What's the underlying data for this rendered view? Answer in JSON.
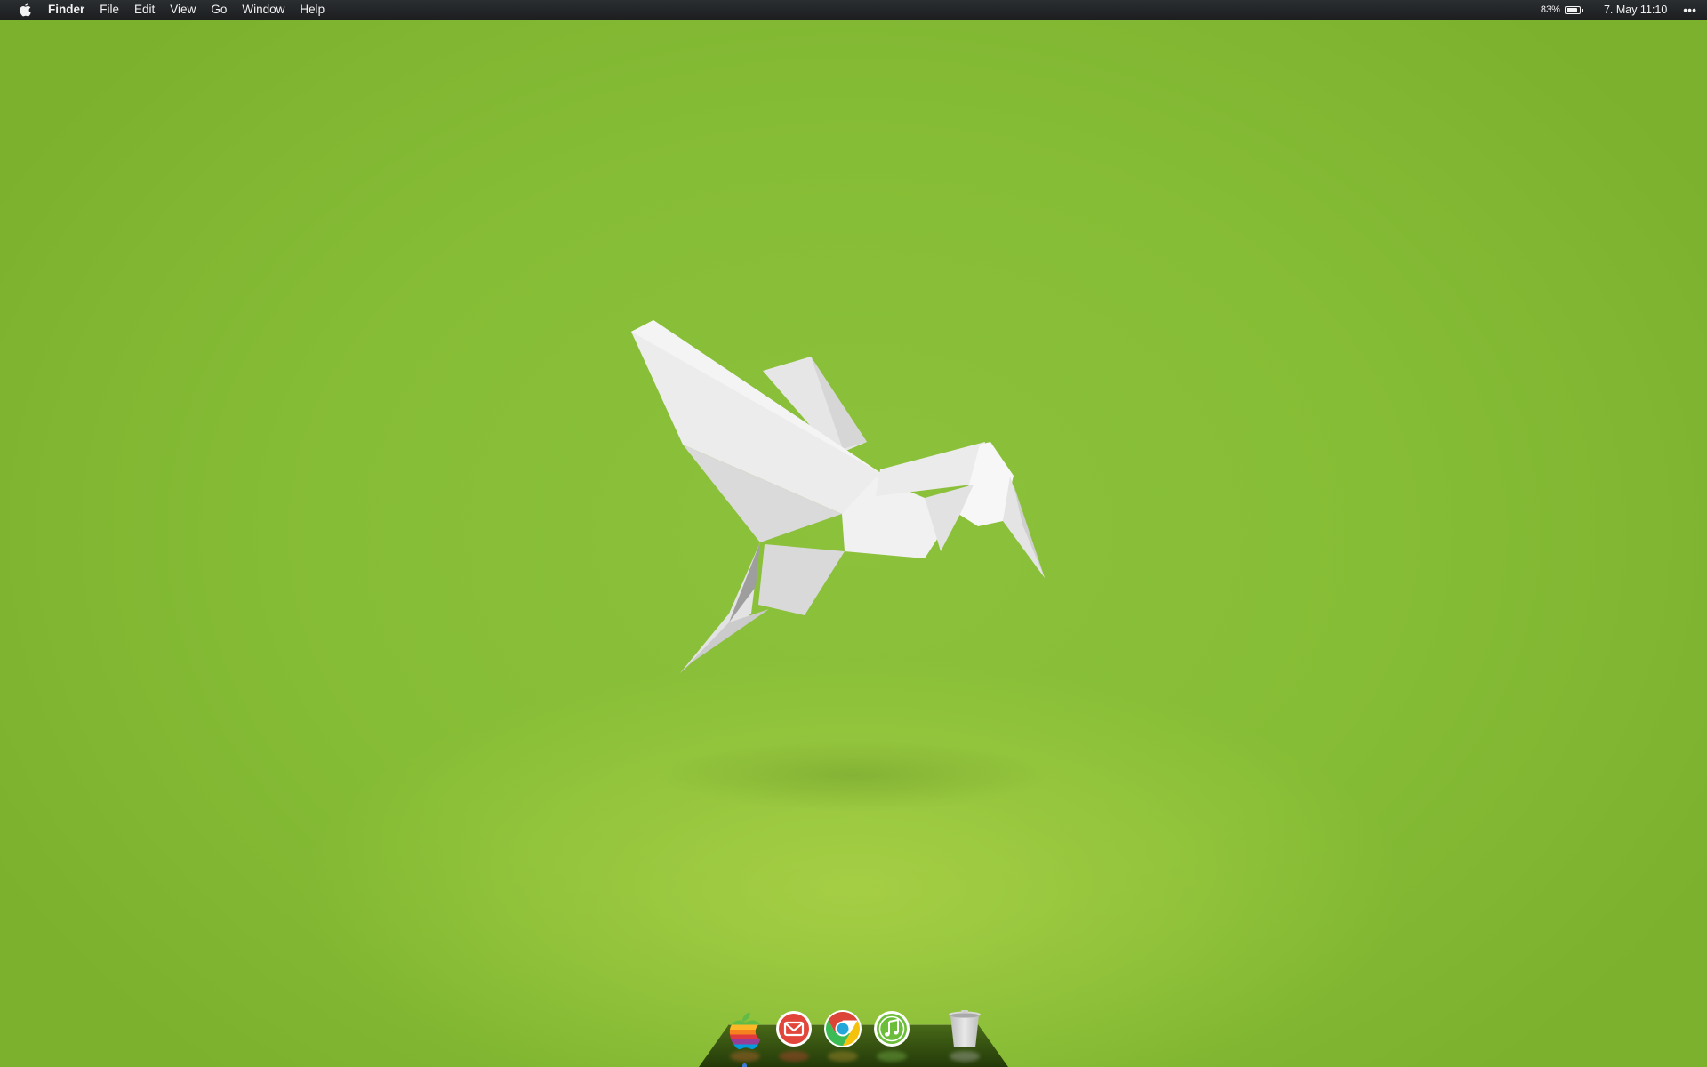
{
  "menubar": {
    "app_name": "Finder",
    "menus": [
      "File",
      "Edit",
      "View",
      "Go",
      "Window",
      "Help"
    ],
    "battery_percent": "83%",
    "battery_level": 0.83,
    "clock": "7. May  11:10",
    "more": "•••"
  },
  "icons": {
    "apple_menu": "apple-logo-icon",
    "battery": "battery-icon",
    "more": "more-dots-icon"
  },
  "dock": {
    "items": [
      {
        "name": "finder",
        "icon": "rainbow-apple-icon"
      },
      {
        "name": "mail",
        "icon": "mail-icon"
      },
      {
        "name": "chrome",
        "icon": "chrome-icon"
      },
      {
        "name": "itunes",
        "icon": "music-note-icon"
      },
      {
        "name": "trash",
        "icon": "trash-icon"
      }
    ]
  },
  "colors": {
    "desktop_green": "#86bd36",
    "menubar_bg": "#1f2123",
    "dock_indicator": "#3a7bd5"
  }
}
